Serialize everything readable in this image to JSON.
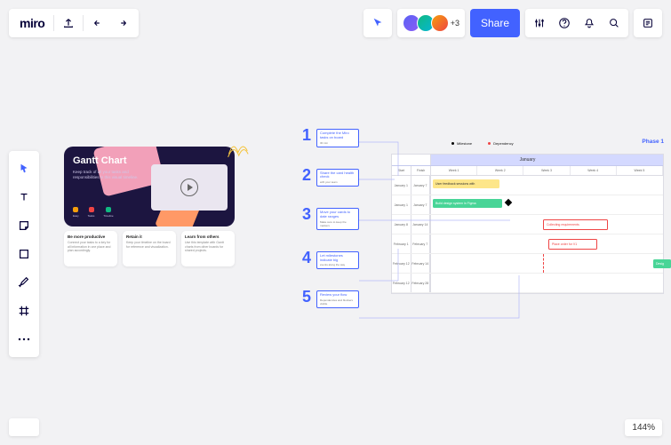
{
  "app": {
    "logo": "miro"
  },
  "collab": {
    "more": "+3",
    "share": "Share"
  },
  "zoom": "144%",
  "gantt_card": {
    "title": "Gantt Chart",
    "subtitle": "Keep track of all your tasks and responsibilities in this visual timeline.",
    "meta": [
      {
        "label": "Easy"
      },
      {
        "label": "Tasks"
      },
      {
        "label": "Timeline"
      }
    ]
  },
  "info_cards": [
    {
      "title": "Be more productive",
      "desc": "Connect your tasks to a key for all information in one place and plan accordingly."
    },
    {
      "title": "Retain it",
      "desc": "Keep your timeline on the board for reference and visualization."
    },
    {
      "title": "Learn from others",
      "desc": "Use this template with Gantt charts from other boards for shared projects."
    }
  ],
  "steps": [
    {
      "n": "1",
      "title": "Complete the Miro tasks on board",
      "desc": "30 min"
    },
    {
      "n": "2",
      "title": "Share the card health check",
      "desc": "with your team"
    },
    {
      "n": "3",
      "title": "Move your cards to date ranges",
      "desc": "Make sure to keep the markers"
    },
    {
      "n": "4",
      "title": "Let milestones indicate big",
      "desc": "events along the way"
    },
    {
      "n": "5",
      "title": "Review your flow",
      "desc": "Dependencies and blockers visible"
    }
  ],
  "gantt": {
    "legend": [
      {
        "label": "Milestone",
        "color": "black"
      },
      {
        "label": "Dependency",
        "color": "red"
      }
    ],
    "phase": "Phase 1",
    "month": "January",
    "col_headers": {
      "start": "Start",
      "finish": "Finish"
    },
    "weeks": [
      "Week 1",
      "Week 2",
      "Week 3",
      "Week 4",
      "Week 5"
    ],
    "rows": [
      {
        "start": "January 1",
        "finish": "January 7"
      },
      {
        "start": "January 1",
        "finish": "January 7"
      },
      {
        "start": "January 8",
        "finish": "January 14"
      },
      {
        "start": "February 1",
        "finish": "February 7"
      },
      {
        "start": "February 12",
        "finish": "February 14"
      },
      {
        "start": "February 12",
        "finish": "February 28"
      }
    ],
    "bars": {
      "feedback": "User feedback sessions with",
      "design": "Build design system in Figma",
      "req": "Collecting requirements",
      "order": "Place order for V1",
      "desig_cut": "Desig"
    }
  }
}
